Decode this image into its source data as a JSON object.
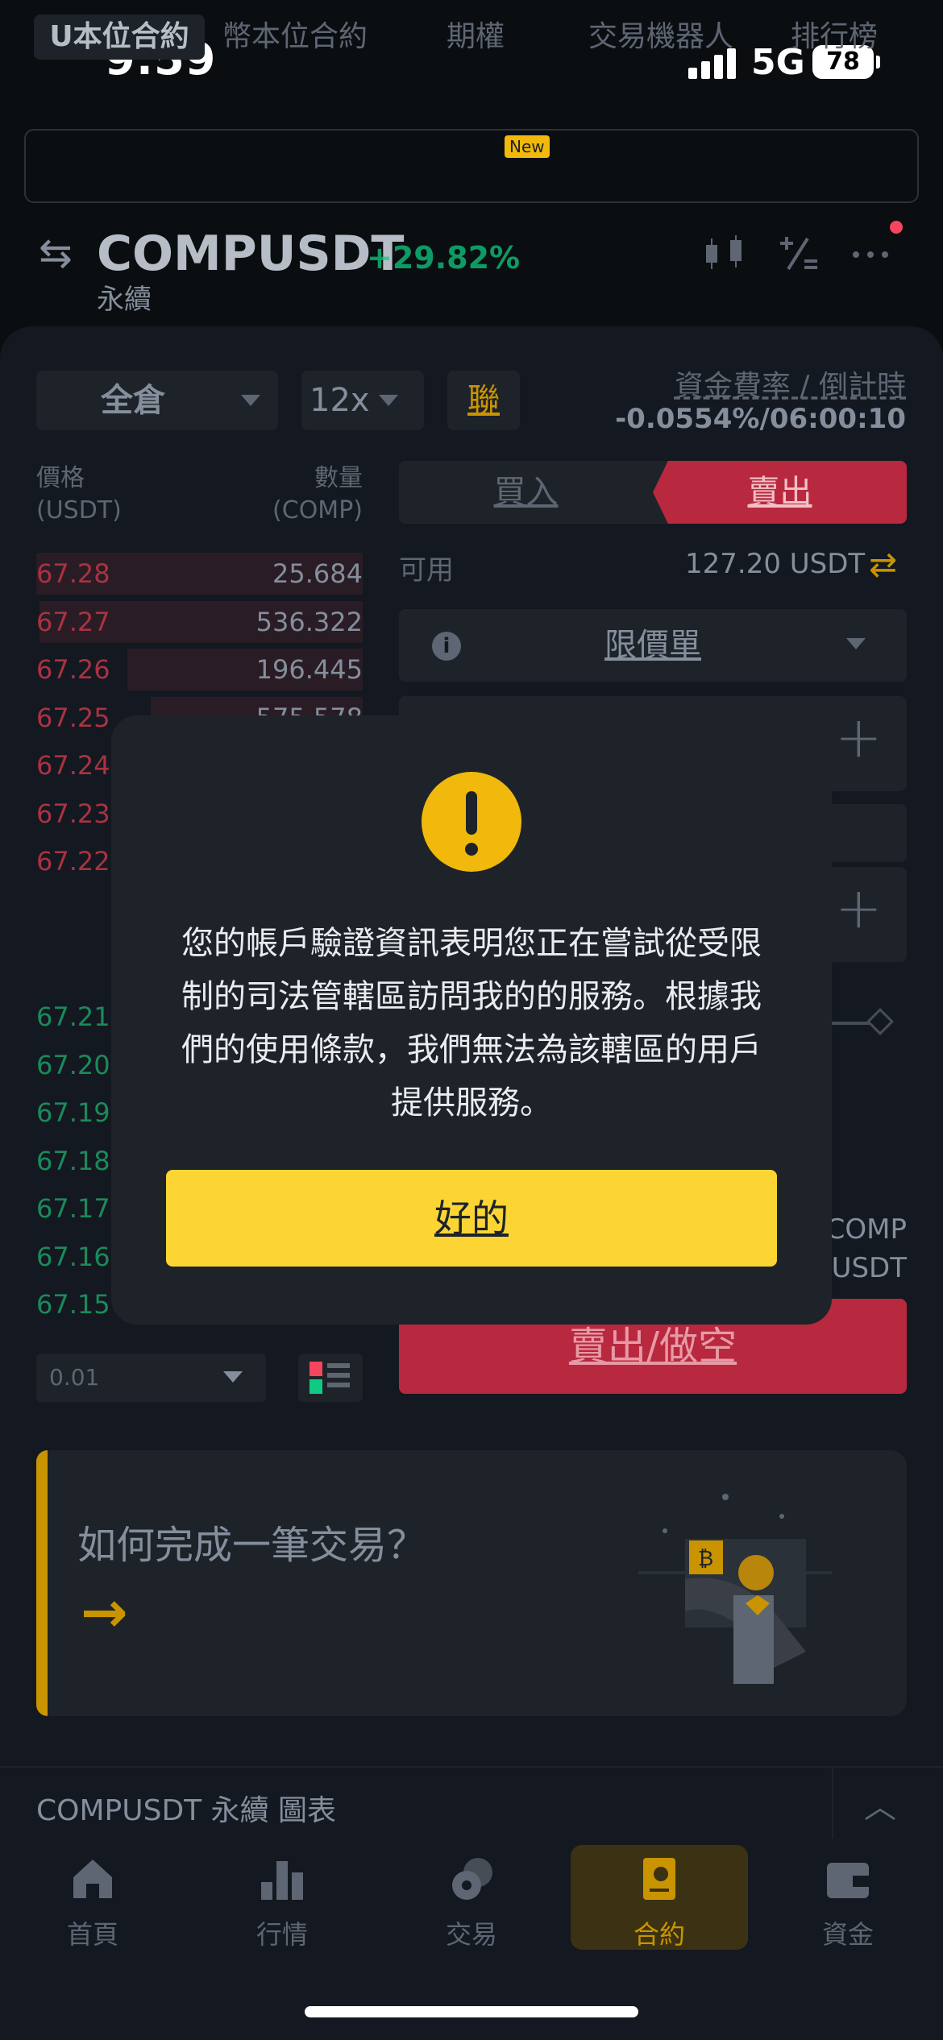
{
  "status": {
    "time": "9:59",
    "network": "5G",
    "battery": "78"
  },
  "tabs": [
    {
      "label": "U本位合約"
    },
    {
      "label": "幣本位合約"
    },
    {
      "label": "期權",
      "badge": "New"
    },
    {
      "label": "交易機器人"
    },
    {
      "label": "排行榜"
    }
  ],
  "header": {
    "symbol": "COMPUSDT",
    "change": "+29.82%",
    "contract_type": "永續"
  },
  "controls": {
    "margin_mode": "全倉",
    "leverage": "12x",
    "linked_label": "聯",
    "funding_label": "資金費率 / 倒計時",
    "funding_value": "-0.0554%/06:00:10"
  },
  "orderbook": {
    "price_header": "價格",
    "price_unit": "(USDT)",
    "qty_header": "數量",
    "qty_unit": "(COMP)",
    "asks": [
      {
        "price": "67.28",
        "qty": "25.684",
        "depth": 1.0
      },
      {
        "price": "67.27",
        "qty": "536.322",
        "depth": 0.99
      },
      {
        "price": "67.26",
        "qty": "196.445",
        "depth": 0.72
      },
      {
        "price": "67.25",
        "qty": "575.578",
        "depth": 0.65
      },
      {
        "price": "67.24",
        "qty": "",
        "depth": 0
      },
      {
        "price": "67.23",
        "qty": "",
        "depth": 0
      },
      {
        "price": "67.22",
        "qty": "",
        "depth": 0
      }
    ],
    "bids": [
      {
        "price": "67.21"
      },
      {
        "price": "67.20"
      },
      {
        "price": "67.19"
      },
      {
        "price": "67.18"
      },
      {
        "price": "67.17"
      },
      {
        "price": "67.16"
      },
      {
        "price": "67.15"
      }
    ],
    "step": "0.01"
  },
  "order_form": {
    "buy_label": "買入",
    "sell_label": "賣出",
    "available_label": "可用",
    "available_value": "127.20 USDT",
    "order_type": "限價單",
    "unit_comp": "COMP",
    "unit_usdt": "USDT",
    "submit_label": "賣出/做空"
  },
  "promo": {
    "title": "如何完成一筆交易？",
    "arrow": "→"
  },
  "chart_bar": {
    "label": "COMPUSDT 永續  圖表"
  },
  "nav": [
    {
      "label": "首頁",
      "icon": "home-icon"
    },
    {
      "label": "行情",
      "icon": "markets-icon"
    },
    {
      "label": "交易",
      "icon": "trade-icon"
    },
    {
      "label": "合約",
      "icon": "futures-icon",
      "active": true
    },
    {
      "label": "資金",
      "icon": "wallet-icon"
    }
  ],
  "modal": {
    "message": "您的帳戶驗證資訊表明您正在嘗試從受限制的司法管轄區訪問我的的服務。根據我們的使用條款，我們無法為該轄區的用戶提供服務。",
    "ok_label": "好的"
  },
  "colors": {
    "accent": "#fcd535",
    "sell": "#f6465d",
    "buy": "#0ecb81",
    "background": "#0b0e11"
  }
}
